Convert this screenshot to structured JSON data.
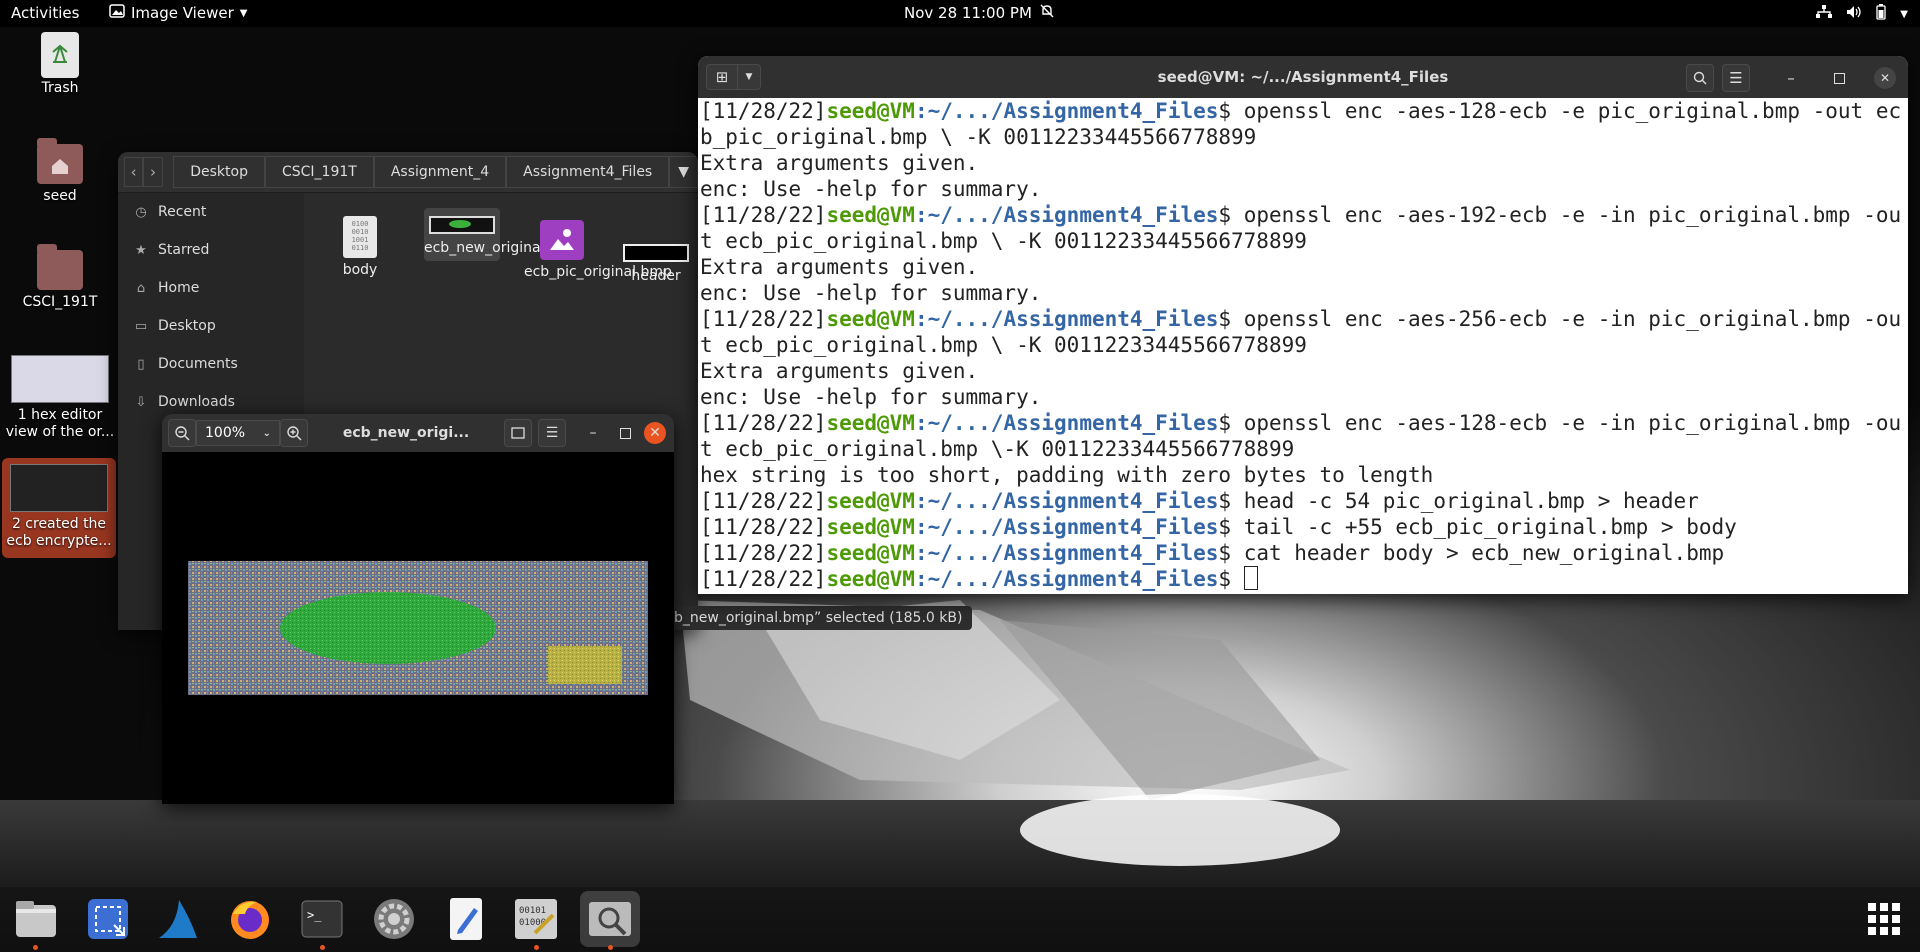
{
  "topbar": {
    "activities": "Activities",
    "app_menu": "Image Viewer",
    "clock": "Nov 28  11:00 PM"
  },
  "desktop": {
    "icons": [
      {
        "label": "Trash"
      },
      {
        "label": "seed"
      },
      {
        "label": "CSCI_191T"
      },
      {
        "label": "1 hex editor view of the or..."
      },
      {
        "label": "2 created the ecb encrypte..."
      }
    ]
  },
  "files": {
    "breadcrumbs": [
      "Desktop",
      "CSCI_191T",
      "Assignment_4",
      "Assignment4_Files"
    ],
    "sidebar": [
      "Recent",
      "Starred",
      "Home",
      "Desktop",
      "Documents",
      "Downloads"
    ],
    "items": [
      {
        "label": "body"
      },
      {
        "label": "ecb_new_original.bmp"
      },
      {
        "label": "ecb_pic_original.bmp"
      },
      {
        "label": "header"
      }
    ],
    "status": "b_new_original.bmp” selected  (185.0 kB)"
  },
  "viewer": {
    "zoom": "100%",
    "title": "ecb_new_origi..."
  },
  "terminal": {
    "title": "seed@VM: ~/.../Assignment4_Files",
    "prompt": {
      "date": "[11/28/22]",
      "user": "seed@VM",
      "path": ":~/.../Assignment4_Files",
      "sym": "$"
    },
    "cmds": [
      " openssl enc -aes-128-ecb -e pic_original.bmp -out ecb_pic_original.bmp \\ -K 00112233445566778899",
      " openssl enc -aes-192-ecb -e -in pic_original.bmp -out ecb_pic_original.bmp \\ -K 00112233445566778899",
      " openssl enc -aes-256-ecb -e -in pic_original.bmp -out ecb_pic_original.bmp \\ -K 00112233445566778899",
      " openssl enc -aes-128-ecb -e -in pic_original.bmp -out ecb_pic_original.bmp \\-K 00112233445566778899",
      " head -c 54 pic_original.bmp > header",
      " tail -c +55 ecb_pic_original.bmp > body",
      " cat header body > ecb_new_original.bmp",
      " "
    ],
    "out_extra": "Extra arguments given.",
    "out_help": "enc: Use -help for summary.",
    "out_short": "hex string is too short, padding with zero bytes to length"
  },
  "dock": {
    "apps": [
      {
        "name": "files"
      },
      {
        "name": "screenshot"
      },
      {
        "name": "wireshark"
      },
      {
        "name": "firefox"
      },
      {
        "name": "terminal"
      },
      {
        "name": "settings"
      },
      {
        "name": "text-editor"
      },
      {
        "name": "hex-editor"
      },
      {
        "name": "image-viewer"
      }
    ]
  }
}
